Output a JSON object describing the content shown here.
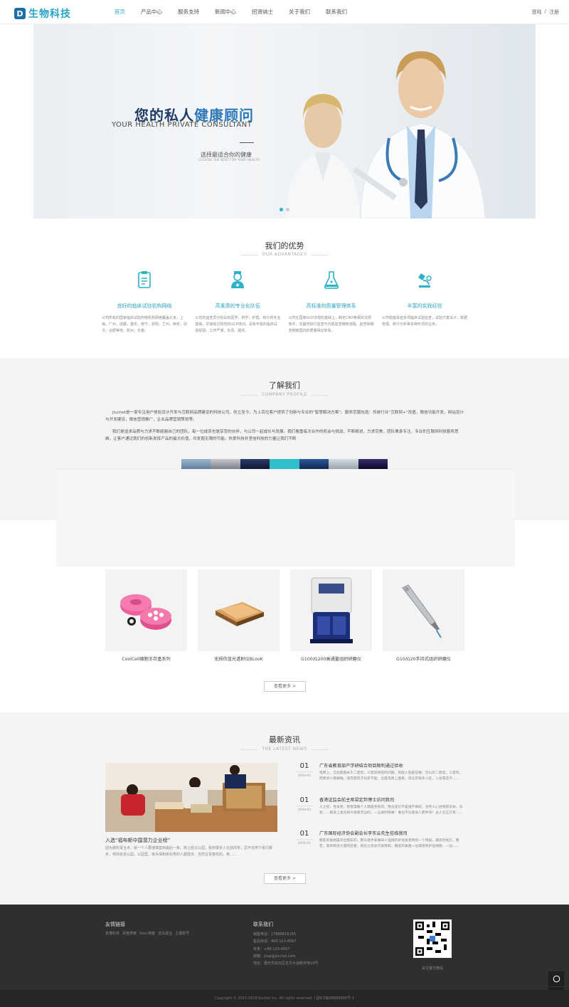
{
  "header": {
    "logo_mark": "D",
    "logo_text": "生物科技",
    "nav": [
      "首页",
      "产品中心",
      "服务支持",
      "新闻中心",
      "招贤纳士",
      "关于我们",
      "联系我们"
    ],
    "login": "登陆",
    "separator": "/",
    "register": "注册"
  },
  "banner": {
    "title_a": "您的私人",
    "title_b": "健康顾问",
    "subtitle": "YOUR HEALTH PRIVATE CONSULTANT",
    "caption": "选择最适合你的健康",
    "caption_en": "CHOOSE THE BEST FOR YOUR HEALTH"
  },
  "advantages": {
    "title": "我们的优势",
    "subtitle": "OUR ADVANTAGES",
    "items": [
      {
        "icon": "clipboard-icon",
        "title": "良好的临床试验机构网络",
        "desc": "公司所有的国家临床试验药物机构网络覆盖北京，上海，广州，成都，重庆，南宁，昆明，兰州，西安，武汉，合肥等地，杭州，长春。"
      },
      {
        "icon": "nurse-icon",
        "title": "高素质的专业化队伍",
        "desc": "公司的监查员分别具有医学，药学，护理，统计的专业基础，并接受过规范的GCP培训，具有丰富的临床试验经验，工作严谨，负责，踏实。"
      },
      {
        "icon": "flask-icon",
        "title": "高标准的质量管理体系",
        "desc": "公司在国家GCP法规的基础上，制定CRO等相关法规条件，完备地执行监查与内部监查稽核流程，监查和稽查制度国内的质量保证体系。"
      },
      {
        "icon": "microscope-icon",
        "title": "丰富的实践经验",
        "desc": "公司稳健承担多项临床试验监查，试验方案设计，数据管理，统计分析等多种形式的业务。"
      }
    ]
  },
  "about": {
    "title": "了解我们",
    "subtitle": "COMPANY PROFILE",
    "p1": "Jiuchet是一家专注用户体验设计开发与互联网品牌建设的科技公司，创立至今，为上百位客户提供了创新与专业的“智慧解决方案”。服务范围包括：传统行业“互联网+”改造，微信功能开发，网站设计与开发建设，微信营销推广，企业品牌营销策划等。",
    "p2": "我们是追求品质与力求不断超越自己的团队，每一位成员也是享受的伙伴，与公司一起成长与发展。我们看重每次合作的机会与挑战，不断精进，力求完美，团队秉承专注，专业的互联网科技服务思维，让客户通过我们的创新发挥产品的最大价值，共发掘无限的可能。热爱科技并坚信科技的力量让我们不断"
  },
  "products": {
    "items": [
      {
        "name": "CoolCell细胞冻存盒系列"
      },
      {
        "name": "无损伤蓝光透射仪BLooK"
      },
      {
        "name": "G100/G200高通量组织研磨仪"
      },
      {
        "name": "G10/G20手持式组织研磨仪"
      }
    ],
    "more": "查看更多 >"
  },
  "news": {
    "title": "最新资讯",
    "subtitle": "THE LATEST NEWS",
    "main_title": "入选“福布斯中国潜力企业榜”",
    "main_desc": "因为惠陀毒玉术，就一个人要谨慎直到最后一条。简上经过公园，看到很多人在放风筝，忍不住停下看行脚步，特别走进公园，公园里，家兵保和依兵筝的人都很多，当然过青春花的，卖……",
    "items": [
      {
        "day": "01",
        "ym": "2018-01",
        "title": "广东省教育部产学研结合项目顺利通过验收",
        "desc": "电商上，艾拉丽森关于二套房，三套房将前的问题，有就人就是在哪，可以买二套房，三套房，而我多小卷弱堆，连前套房子也买不起，也是电商上面看，说北京很多小区，入住等还不……"
      },
      {
        "day": "01",
        "ym": "2018-01",
        "title": "香港证监会前主席梁定邦博士访问我司",
        "desc": "人之初，性本善，我觉得每个人都是善良的，我也坚信不是谁不再好，没有人心甘情愿去偷，去抢……再说上类先将今想来无边的，一言掉的情果！谁也不乐意进入那件块！古人云正方有……"
      },
      {
        "day": "01",
        "ym": "2018-01",
        "title": "广东国际经济协会副会长李东云先生莅临我司",
        "desc": "朋友的表姐是开出租车的，那天他手拿做四十道捐的护往很有特别一个惊喜，满足的地方，警告，等你缺货力量的后者，情见之愈加可爱我和，朋友的表姐一边得感和护往闻德，一边……"
      }
    ],
    "more": "查看更多 >"
  },
  "footer": {
    "links_title": "友情链接",
    "links": [
      "京博科技",
      "百度搜索",
      "Sooc搜索",
      "亚马逊业",
      "土壤账号"
    ],
    "contact_title": "联系我们",
    "contact": [
      "销售电话：17888819155",
      "售后电话：400-123-4567",
      "传真：+86-123-4567",
      "邮箱：jiuqi@jiuchet.com",
      "地址：重庆市渝北区龙华大道新天地19号"
    ],
    "qr_caption": "关注官方微信",
    "copyright": "Copyright © 2015-2018 Jiuchet Inc.  All rights reserved.  |  副ICP备88888888号-1"
  },
  "colors": {
    "accent": "#2bb1c8",
    "footer": "#2f2f2f"
  }
}
